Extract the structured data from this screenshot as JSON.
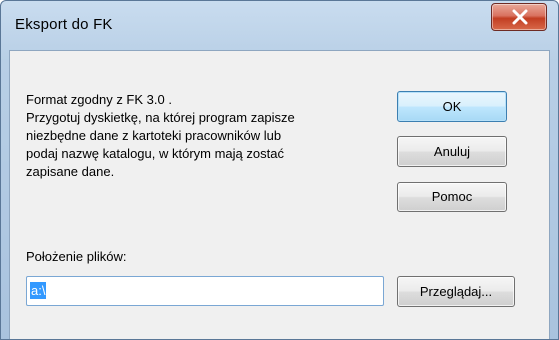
{
  "window": {
    "title": "Eksport do FK"
  },
  "description": {
    "lines": [
      "Format zgodny z FK 3.0 .",
      "Przygotuj dyskietkę, na której program zapisze",
      "niezbędne dane z kartoteki pracowników lub",
      "podaj nazwę katalogu, w którym mają zostać",
      "zapisane dane."
    ]
  },
  "buttons": {
    "ok": "OK",
    "cancel": "Anuluj",
    "help": "Pomoc",
    "browse": "Przeglądaj..."
  },
  "location": {
    "label": "Położenie plików:",
    "value": "a:\\",
    "selected": true
  },
  "icons": {
    "close": "close-icon"
  },
  "colors": {
    "selection": "#3399ff",
    "close_button": "#c23e22",
    "default_button_border": "#3c7fb1"
  }
}
